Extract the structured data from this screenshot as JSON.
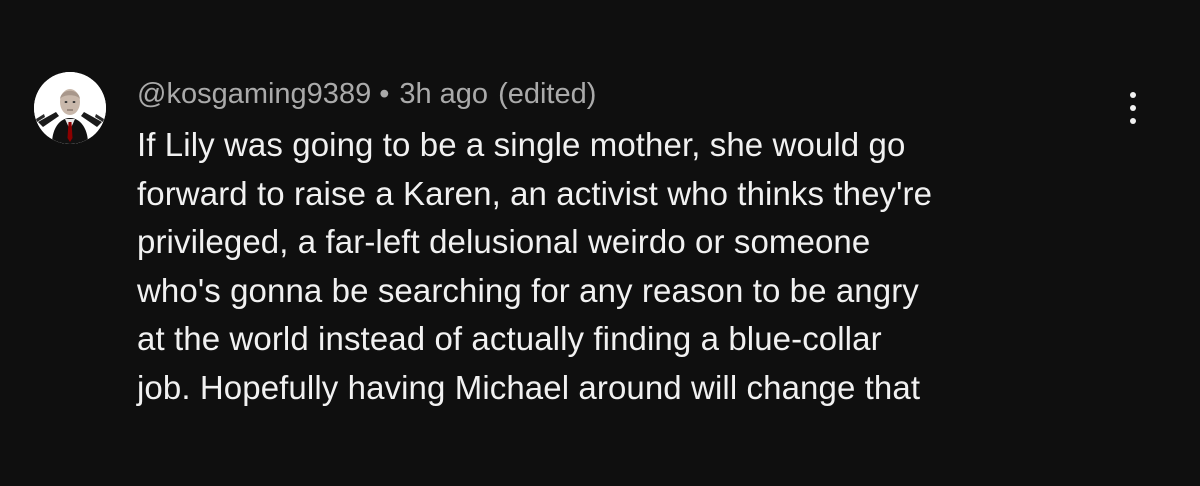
{
  "comment": {
    "author_handle": "@kosgaming9389",
    "separator": "•",
    "timestamp": "3h ago",
    "edited_label": "(edited)",
    "avatar_icon": "hitman-avatar",
    "menu_icon": "more-vertical-icon",
    "text_lines": [
      "If Lily was going to be a single mother, she would go",
      "forward to raise a Karen, an activist who thinks they're",
      "privileged, a far-left delusional weirdo or someone",
      "who's gonna be searching for any reason to be angry",
      "at the world instead of actually finding a blue-collar",
      "job. Hopefully having Michael around will change that"
    ]
  },
  "colors": {
    "background": "#0f0f0f",
    "meta_text": "#aaaaaa",
    "body_text": "#f1f1f1"
  }
}
